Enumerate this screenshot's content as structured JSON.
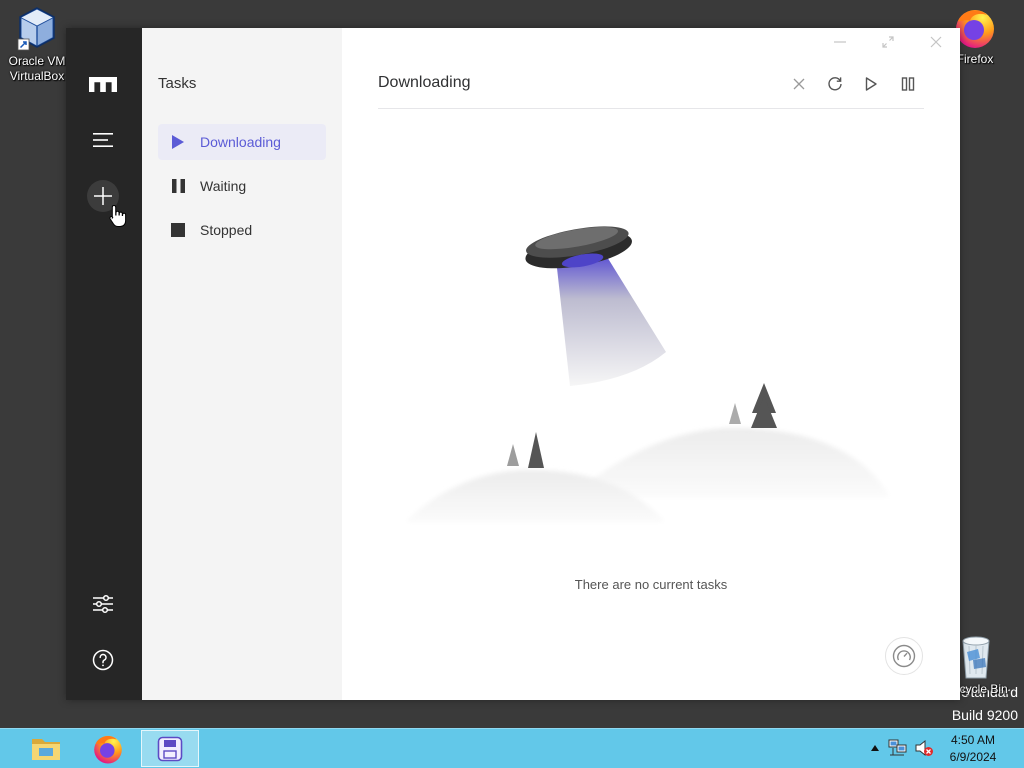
{
  "colors": {
    "desktop_bg": "#3a3a3a",
    "sidebar_bg": "#262626",
    "tasks_panel_bg": "#f4f4f4",
    "main_bg": "#ffffff",
    "accent": "#5b5bd6",
    "active_item_bg": "#ebebf6",
    "taskbar_bg": "#62c8e9"
  },
  "desktop": {
    "virtualbox": {
      "icon": "virtualbox-icon",
      "label_line1": "Oracle VM",
      "label_line2": "VirtualBox"
    },
    "firefox": {
      "icon": "firefox-icon",
      "label": "Firefox"
    },
    "recycle_bin": {
      "icon": "recycle-bin-icon",
      "label": "Recycle Bin"
    },
    "watermark": {
      "edition": "Standard",
      "build": "Build 9200"
    }
  },
  "motrix": {
    "window_controls": [
      "minimize-icon",
      "maximize-icon",
      "close-icon"
    ],
    "sidebar": {
      "top": [
        "motrix-logo-icon",
        "menu-icon",
        "add-task-icon"
      ],
      "bottom": [
        "settings-icon",
        "help-icon"
      ]
    },
    "tasks_panel": {
      "title": "Tasks",
      "items": [
        {
          "label": "Downloading",
          "icon": "play-icon",
          "active": true
        },
        {
          "label": "Waiting",
          "icon": "pause-icon",
          "active": false
        },
        {
          "label": "Stopped",
          "icon": "stop-icon",
          "active": false
        }
      ]
    },
    "main": {
      "title": "Downloading",
      "actions": [
        "delete-icon",
        "refresh-icon",
        "resume-all-icon",
        "pause-all-icon"
      ],
      "empty_message": "There are no current tasks",
      "speedometer_icon": "speedometer-icon"
    }
  },
  "taskbar": {
    "apps": [
      {
        "icon": "file-explorer-icon",
        "active": false
      },
      {
        "icon": "firefox-icon",
        "active": false
      },
      {
        "icon": "motrix-icon",
        "active": true
      }
    ],
    "tray": {
      "icons": [
        "show-hidden-icons-arrow",
        "network-icon",
        "volume-muted-icon"
      ],
      "time": "4:50 AM",
      "date": "6/9/2024"
    }
  }
}
